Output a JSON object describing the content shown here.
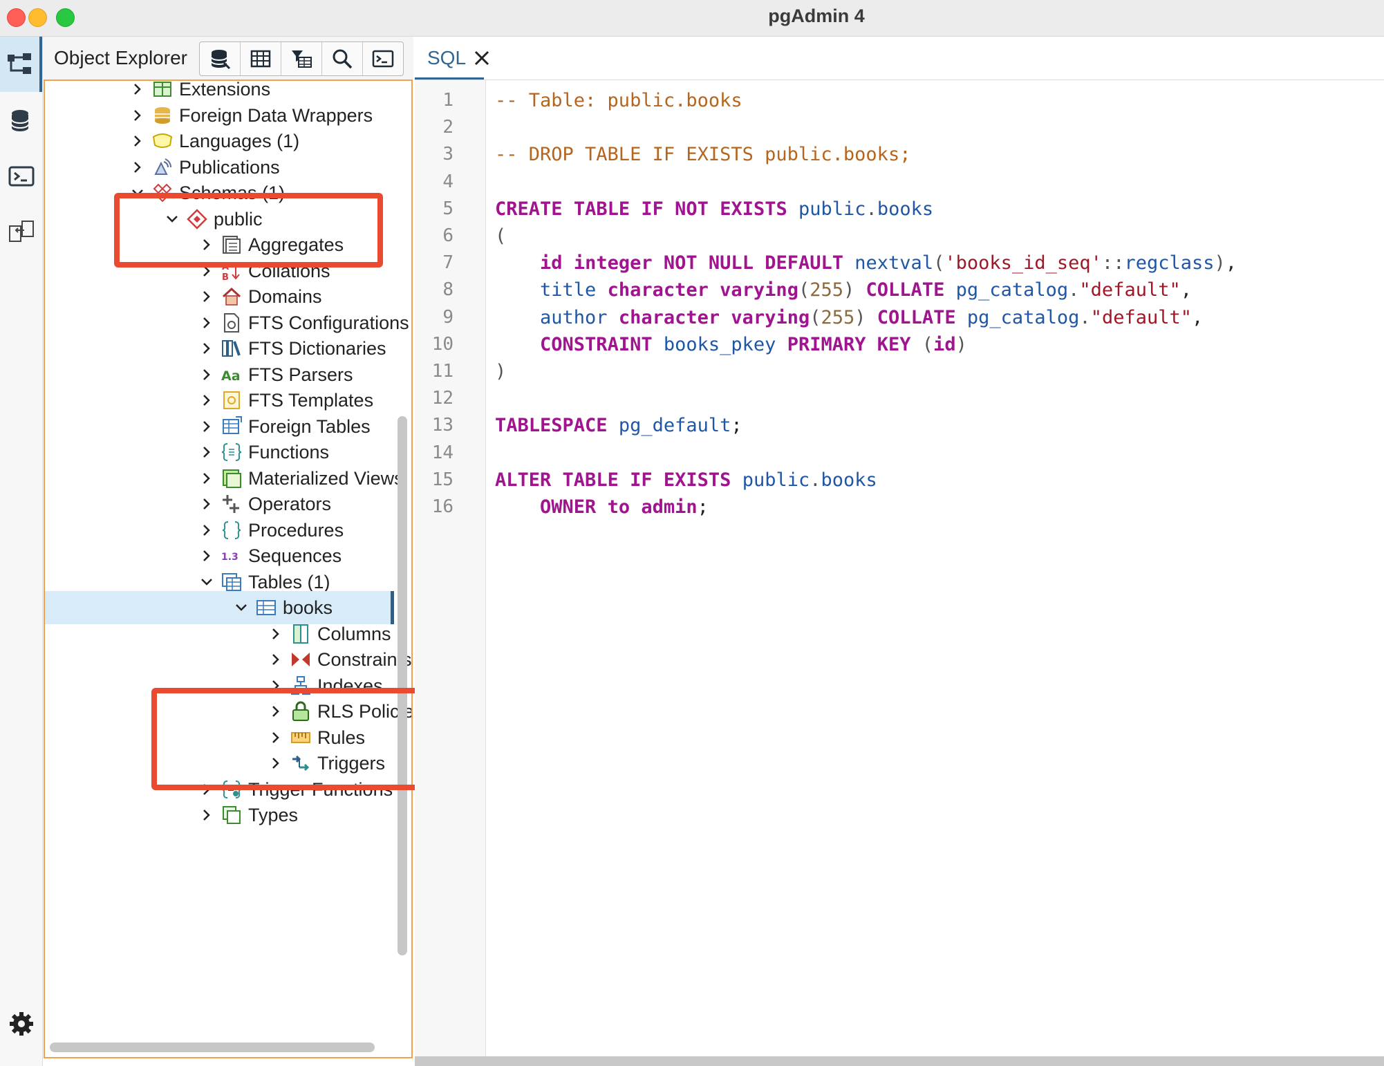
{
  "window": {
    "title": "pgAdmin 4"
  },
  "rail": {
    "items": [
      "object-explorer-icon",
      "database-icon",
      "terminal-icon",
      "schema-diff-icon",
      "settings-icon"
    ]
  },
  "object_explorer": {
    "title": "Object Explorer",
    "toolbar": [
      "query-tool-icon",
      "view-data-icon",
      "filtered-rows-icon",
      "search-objects-icon",
      "psql-tool-icon"
    ],
    "tree": [
      {
        "label": "Extensions",
        "icon": "extensions-icon",
        "expanded": false
      },
      {
        "label": "Foreign Data Wrappers",
        "icon": "foreign-data-wrapper-icon",
        "expanded": false
      },
      {
        "label": "Languages (1)",
        "icon": "language-icon",
        "expanded": false
      },
      {
        "label": "Publications",
        "icon": "publication-icon",
        "expanded": false
      },
      {
        "label": "Schemas (1)",
        "icon": "schemas-icon",
        "expanded": true
      },
      {
        "label": "public",
        "icon": "schema-icon",
        "expanded": true
      },
      {
        "label": "Aggregates",
        "icon": "aggregate-icon",
        "expanded": false
      },
      {
        "label": "Collations",
        "icon": "collation-icon",
        "expanded": false
      },
      {
        "label": "Domains",
        "icon": "domain-icon",
        "expanded": false
      },
      {
        "label": "FTS Configurations",
        "icon": "fts-configuration-icon",
        "expanded": false
      },
      {
        "label": "FTS Dictionaries",
        "icon": "fts-dictionary-icon",
        "expanded": false
      },
      {
        "label": "FTS Parsers",
        "icon": "fts-parser-icon",
        "expanded": false
      },
      {
        "label": "FTS Templates",
        "icon": "fts-template-icon",
        "expanded": false
      },
      {
        "label": "Foreign Tables",
        "icon": "foreign-table-icon",
        "expanded": false
      },
      {
        "label": "Functions",
        "icon": "function-icon",
        "expanded": false
      },
      {
        "label": "Materialized Views",
        "icon": "materialized-view-icon",
        "expanded": false
      },
      {
        "label": "Operators",
        "icon": "operator-icon",
        "expanded": false
      },
      {
        "label": "Procedures",
        "icon": "procedure-icon",
        "expanded": false
      },
      {
        "label": "Sequences",
        "icon": "sequence-icon",
        "expanded": false
      },
      {
        "label": "Tables (1)",
        "icon": "tables-icon",
        "expanded": true
      },
      {
        "label": "books",
        "icon": "table-icon",
        "expanded": true,
        "selected": true
      },
      {
        "label": "Columns",
        "icon": "columns-icon",
        "expanded": false
      },
      {
        "label": "Constraints",
        "icon": "constraints-icon",
        "expanded": false
      },
      {
        "label": "Indexes",
        "icon": "indexes-icon",
        "expanded": false
      },
      {
        "label": "RLS Policies",
        "icon": "rls-policy-icon",
        "expanded": false
      },
      {
        "label": "Rules",
        "icon": "rules-icon",
        "expanded": false
      },
      {
        "label": "Triggers",
        "icon": "triggers-icon",
        "expanded": false
      },
      {
        "label": "Trigger Functions",
        "icon": "trigger-function-icon",
        "expanded": false
      },
      {
        "label": "Types",
        "icon": "types-icon",
        "expanded": false
      }
    ]
  },
  "sql_tab": {
    "label": "SQL"
  },
  "sql": {
    "line_numbers": [
      "1",
      "2",
      "3",
      "4",
      "5",
      "6",
      "7",
      "8",
      "9",
      "10",
      "11",
      "12",
      "13",
      "14",
      "15",
      "16"
    ],
    "lines": [
      "-- Table: public.books",
      "",
      "-- DROP TABLE IF EXISTS public.books;",
      "",
      "CREATE TABLE IF NOT EXISTS public.books",
      "(",
      "    id integer NOT NULL DEFAULT nextval('books_id_seq'::regclass),",
      "    title character varying(255) COLLATE pg_catalog.\"default\",",
      "    author character varying(255) COLLATE pg_catalog.\"default\",",
      "    CONSTRAINT books_pkey PRIMARY KEY (id)",
      ")",
      "",
      "TABLESPACE pg_default;",
      "",
      "ALTER TABLE IF EXISTS public.books",
      "    OWNER to admin;"
    ]
  },
  "colors": {
    "accent": "#326690",
    "highlight_box": "#ea4a30",
    "selection": "#d7ebf9",
    "sql_keyword": "#a0158f",
    "sql_comment": "#b5651d",
    "sql_identifier": "#1f56a6",
    "sql_string": "#a11626"
  }
}
